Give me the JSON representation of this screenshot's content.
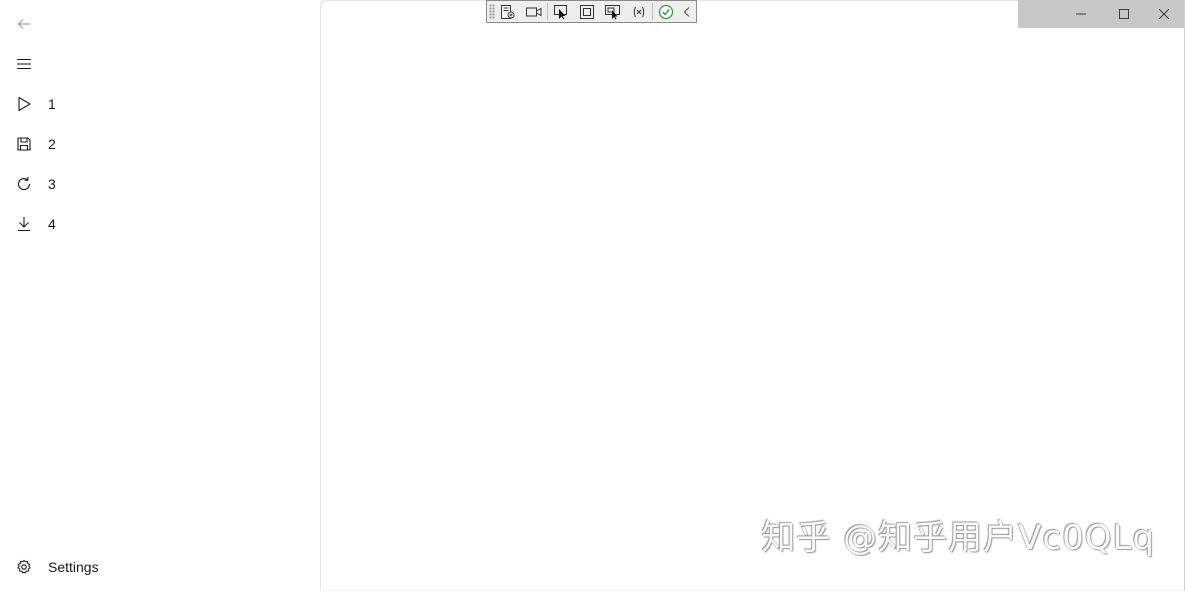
{
  "nav": {
    "items": [
      {
        "label": "1",
        "icon": "play-icon"
      },
      {
        "label": "2",
        "icon": "save-icon"
      },
      {
        "label": "3",
        "icon": "refresh-icon"
      },
      {
        "label": "4",
        "icon": "download-icon"
      }
    ],
    "settings_label": "Settings"
  },
  "watermark": "知乎 @知乎用户Vc0QLq",
  "colors": {
    "nav_background": "#ffffff",
    "content_background": "#ffffff",
    "caption_background": "#c8c8c8",
    "toolbar_check": "#2ea043"
  }
}
